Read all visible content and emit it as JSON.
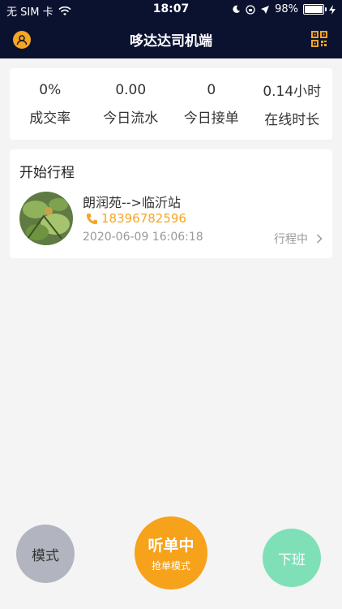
{
  "status_bar": {
    "carrier": "无 SIM 卡",
    "time": "18:07",
    "battery_pct": "98%",
    "battery_level": 0.98
  },
  "header": {
    "title": "哆达达司机端",
    "avatar_icon": "user-circle-icon",
    "qr_icon": "qr-code-icon"
  },
  "stats": [
    {
      "value": "0%",
      "label": "成交率"
    },
    {
      "value": "0.00",
      "label": "今日流水"
    },
    {
      "value": "0",
      "label": "今日接单"
    },
    {
      "value": "0.14小时",
      "label": "在线时长"
    }
  ],
  "trip": {
    "section_title": "开始行程",
    "route": "朗润苑-->临沂站",
    "phone": "18396782596",
    "datetime": "2020-06-09 16:06:18",
    "status": "行程中"
  },
  "actions": {
    "mode_label": "模式",
    "listen_label": "听单中",
    "listen_sub": "抢单模式",
    "off_label": "下班"
  },
  "colors": {
    "header_bg": "#0b1230",
    "accent": "#f5a623",
    "off_button": "#7fe0b8",
    "mode_button": "#b2b5bf"
  }
}
